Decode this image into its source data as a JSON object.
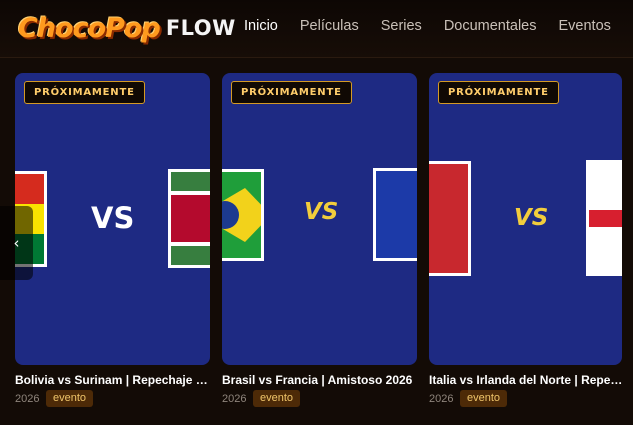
{
  "header": {
    "logo_text": "ChocoPop",
    "logo_suffix": "FLOW",
    "nav": [
      {
        "label": "Inicio",
        "active": true
      },
      {
        "label": "Películas",
        "active": false
      },
      {
        "label": "Series",
        "active": false
      },
      {
        "label": "Documentales",
        "active": false
      },
      {
        "label": "Eventos",
        "active": false
      }
    ]
  },
  "carousel": {
    "prev_icon": "chevron-left-icon",
    "prev_glyph": "‹",
    "cards": [
      {
        "badge": "PRÓXIMAMENTE",
        "vs_text": "VS",
        "title": "Bolivia vs Surinam | Repechaje Wo…",
        "year": "2026",
        "tag": "evento",
        "colors": {
          "background": "#1e2a83",
          "vs": "#ffffff"
        }
      },
      {
        "badge": "PRÓXIMAMENTE",
        "vs_text": "VS",
        "title": "Brasil vs Francia | Amistoso 2026",
        "year": "2026",
        "tag": "evento",
        "colors": {
          "background": "#1e2a83",
          "vs": "#f2cd3c"
        }
      },
      {
        "badge": "PRÓXIMAMENTE",
        "vs_text": "VS",
        "title": "Italia vs Irlanda del Norte | Repechaje",
        "year": "2026",
        "tag": "evento",
        "colors": {
          "background": "#1e2a83",
          "vs": "#f2cd3c"
        }
      }
    ]
  },
  "colors": {
    "accent": "#ff9a1e",
    "badge_text": "#ffcd6b",
    "badge_border": "#d49a25",
    "tag_background": "#4d2a07",
    "page_background": "#130b06"
  }
}
